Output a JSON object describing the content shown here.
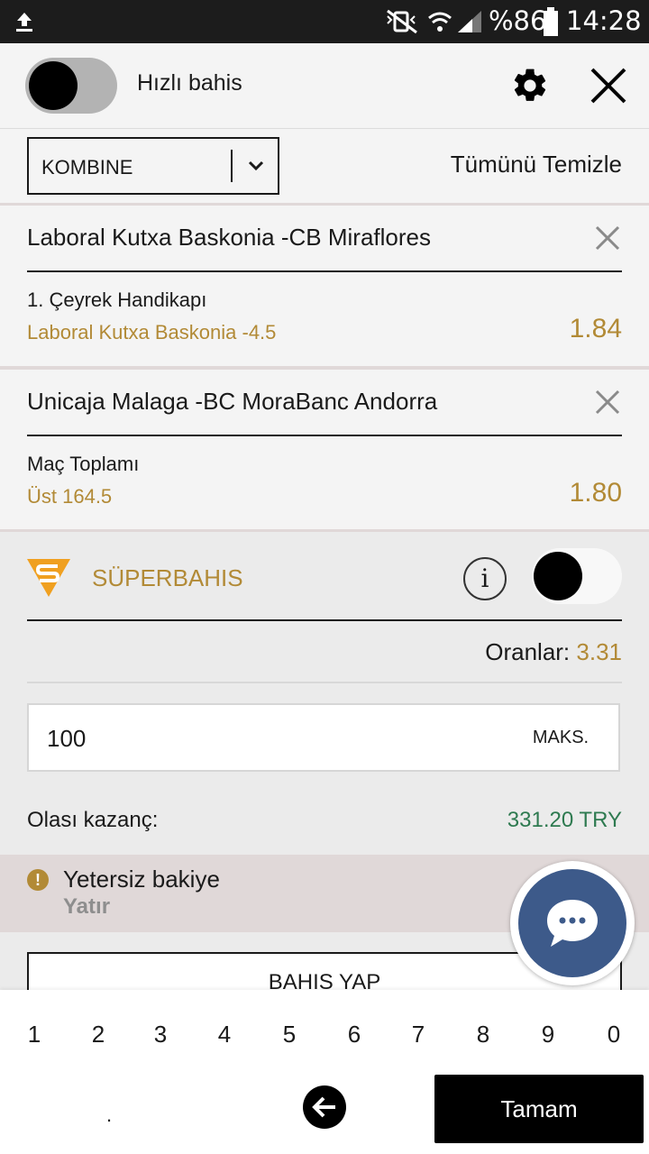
{
  "status_bar": {
    "battery": "%86",
    "time": "14:28"
  },
  "header": {
    "quick_bet_label": "Hızlı bahis"
  },
  "bet_type": {
    "selected": "KOMBINE",
    "clear_all": "Tümünü Temizle"
  },
  "bets": [
    {
      "match": "Laboral Kutxa Baskonia -CB Miraflores",
      "market": "1. Çeyrek Handikapı",
      "selection": "Laboral Kutxa Baskonia -4.5",
      "odds": "1.84"
    },
    {
      "match": "Unicaja Malaga -BC MoraBanc Andorra",
      "market": "Maç Toplamı",
      "selection": "Üst 164.5",
      "odds": "1.80"
    }
  ],
  "superbahis": {
    "title": "SÜPERBAHIS",
    "info_glyph": "i",
    "odds_label": "Oranlar:",
    "odds_value": "3.31",
    "stake_value": "100",
    "max_label": "MAKS.",
    "potential_win_label": "Olası kazanç:",
    "potential_win_value": "331.20 TRY",
    "warning_title": "Yetersiz bakiye",
    "warning_link": "Yatır",
    "place_bet": "BAHIS YAP"
  },
  "keypad": {
    "keys": [
      "1",
      "2",
      "3",
      "4",
      "5",
      "6",
      "7",
      "8",
      "9",
      "0"
    ],
    "dot": ".",
    "done": "Tamam"
  },
  "colors": {
    "accent_gold": "#b28a36",
    "win_green": "#2e7a50",
    "chat_blue": "#3d5a8a"
  }
}
